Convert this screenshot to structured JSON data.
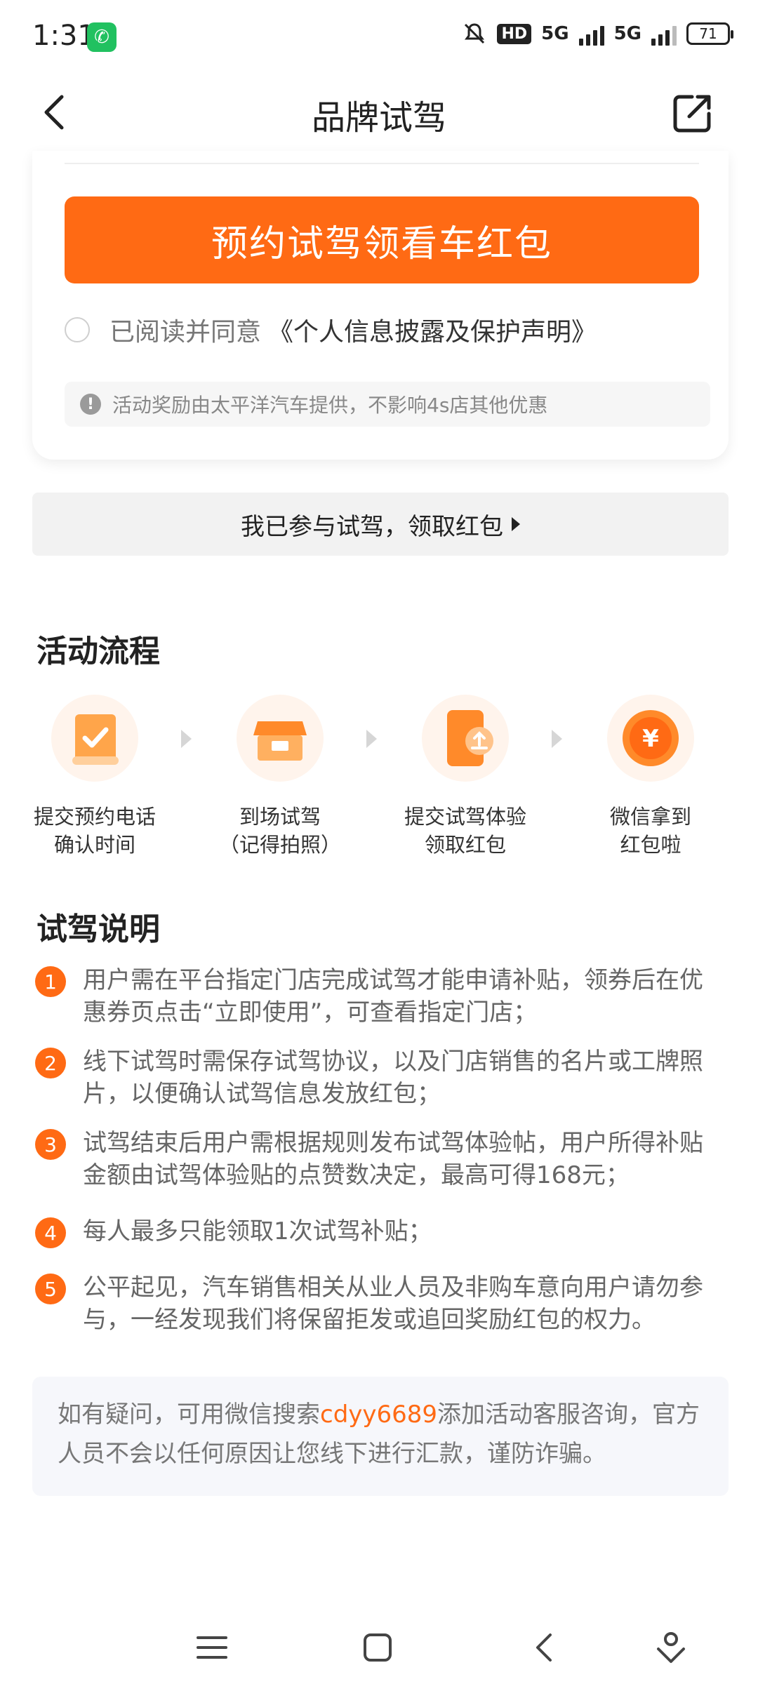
{
  "status_bar": {
    "time": "1:31",
    "hd_label": "HD",
    "network_1": "5G",
    "network_2": "5G",
    "battery": "71",
    "icons": [
      "phone-icon",
      "mute-icon",
      "hd-icon",
      "signal-icon",
      "signal-icon",
      "battery-icon"
    ]
  },
  "header": {
    "title": "品牌试驾"
  },
  "card": {
    "reserve_button": "预约试驾领看车红包",
    "agree_text": "已阅读并同意",
    "agree_link": "《个人信息披露及保护声明》",
    "notice": "活动奖励由太平洋汽车提供，不影响4s店其他优惠",
    "notice_icon": "!"
  },
  "claim_button": "我已参与试驾，领取红包",
  "flow": {
    "title": "活动流程",
    "steps": [
      {
        "line1": "提交预约电话",
        "line2": "确认时间",
        "icon": "document-check-icon"
      },
      {
        "line1": "到场试驾",
        "line2": "（记得拍照）",
        "icon": "store-icon"
      },
      {
        "line1": "提交试驾体验",
        "line2": "领取红包",
        "icon": "upload-phone-icon"
      },
      {
        "line1": "微信拿到",
        "line2": "红包啦",
        "icon": "yen-coin-icon"
      }
    ],
    "coin_symbol": "¥"
  },
  "rules": {
    "title": "试驾说明",
    "items": [
      {
        "num": "1",
        "text": "用户需在平台指定门店完成试驾才能申请补贴，领券后在优惠券页点击“立即使用”，可查看指定门店；"
      },
      {
        "num": "2",
        "text": "线下试驾时需保存试驾协议，以及门店销售的名片或工牌照片，以便确认试驾信息发放红包；"
      },
      {
        "num": "3",
        "text": "试驾结束后用户需根据规则发布试驾体验帖，用户所得补贴金额由试驾体验贴的点赞数决定，最高可得168元；"
      },
      {
        "num": "4",
        "text": "每人最多只能领取1次试驾补贴；"
      },
      {
        "num": "5",
        "text": "公平起见，汽车销售相关从业人员及非购车意向用户请勿参与，一经发现我们将保留拒发或追回奖励红包的权力。"
      }
    ]
  },
  "info": {
    "before": "如有疑问，可用微信搜索",
    "highlight": "cdyy6689",
    "after": "添加活动客服咨询，官方人员不会以任何原因让您线下进行汇款，谨防诈骗。"
  },
  "colors": {
    "accent": "#ff6a14",
    "text_primary": "#222222",
    "text_secondary": "#666666",
    "claim_bg": "#f2f2f2",
    "info_bg": "#f6f7fb"
  }
}
